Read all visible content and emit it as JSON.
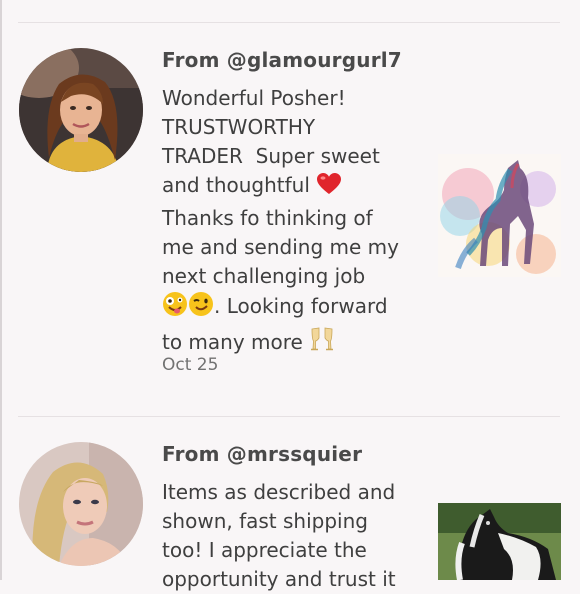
{
  "reviews": [
    {
      "from": "From @glamourgurl7",
      "lines": [
        "Wonderful Posher!",
        "TRUSTWORTHY",
        "TRADER  Super sweet",
        "and thoughtful",
        "Thanks fo thinking of",
        "me and sending me my",
        "next challenging job",
        ". Looking forward",
        "to many more"
      ],
      "emoji": [
        "red-heart",
        "zany-face",
        "winking-face",
        "clinking-glasses"
      ],
      "date": "Oct 25",
      "thumbnail": "watercolor-horse"
    },
    {
      "from": "From @mrssquier",
      "lines": [
        "Items as described and",
        "shown, fast shipping",
        "too! I appreciate the",
        "opportunity and trust it"
      ],
      "thumbnail": "piebald-horse-photo"
    }
  ],
  "colors": {
    "background": "#f9f6f7",
    "divider": "#e6e1e3",
    "text": "#3f3f3f",
    "muted": "#727272"
  }
}
